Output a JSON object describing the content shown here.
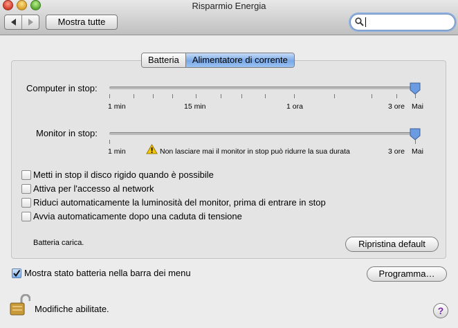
{
  "window": {
    "title": "Risparmio Energia"
  },
  "toolbar": {
    "show_all_label": "Mostra tutte",
    "back_icon": "back-arrow-icon",
    "forward_icon": "forward-arrow-icon",
    "search_value": ""
  },
  "tabs": [
    {
      "label": "Batteria",
      "selected": false
    },
    {
      "label": "Alimentatore di corrente",
      "selected": true
    }
  ],
  "computer_sleep": {
    "label": "Computer in stop:",
    "ticks": [
      "1 min",
      "15 min",
      "1 ora",
      "3 ore",
      "Mai"
    ],
    "value": "Mai"
  },
  "display_sleep": {
    "label": "Monitor in stop:",
    "ticks": [
      "1 min",
      "3 ore",
      "Mai"
    ],
    "warning": "Non lasciare mai il monitor in stop può ridurre la sua durata",
    "value": "Mai"
  },
  "options": [
    {
      "label": "Metti in stop il disco rigido quando è possibile",
      "checked": false
    },
    {
      "label": "Attiva per l'accesso al network",
      "checked": false
    },
    {
      "label": "Riduci automaticamente la luminosità del monitor, prima di entrare in stop",
      "checked": false
    },
    {
      "label": "Avvia automaticamente dopo una caduta di tensione",
      "checked": false
    }
  ],
  "status": {
    "battery_text": "Batteria carica."
  },
  "buttons": {
    "restore_defaults": "Ripristina default",
    "schedule": "Programma…"
  },
  "menu_bar_option": {
    "label": "Mostra stato batteria nella barra dei menu",
    "checked": true
  },
  "lock": {
    "text": "Modifiche abilitate.",
    "icon": "unlocked-padlock-icon"
  },
  "help": {
    "label": "?"
  }
}
